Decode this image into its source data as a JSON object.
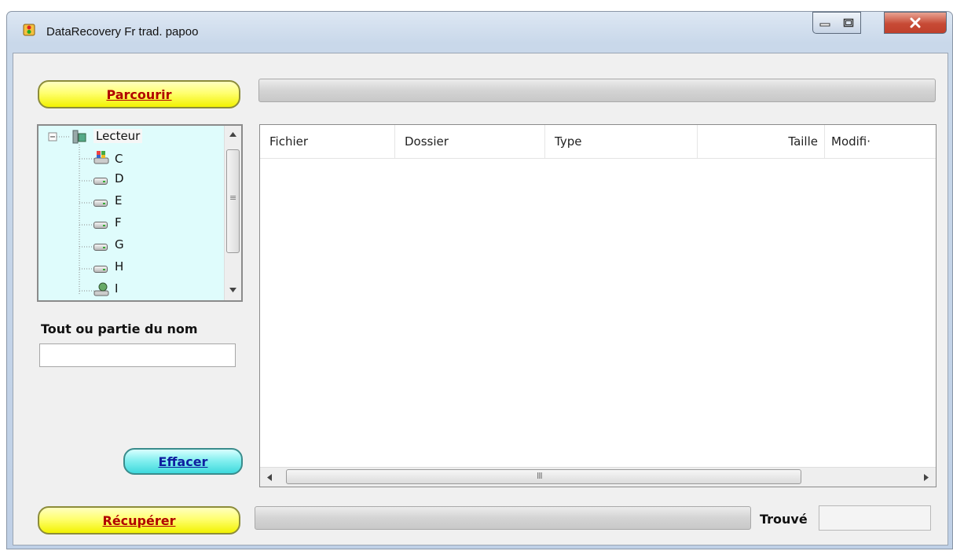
{
  "window": {
    "title": "DataRecovery Fr trad. papoo",
    "controls": {
      "minimize": "—",
      "maximize": "□",
      "close": "X"
    }
  },
  "toolbar": {
    "browse_label": "Parcourir",
    "browse_hotkey_letter": "P"
  },
  "tree": {
    "root": "Lecteur",
    "drives": [
      "C",
      "D",
      "E",
      "F",
      "G",
      "H",
      "I"
    ],
    "expand_symbol": "⊟",
    "scroll_mid_glyph": "≡"
  },
  "filter": {
    "label": "Tout ou partie du nom",
    "value": ""
  },
  "buttons": {
    "clear_label": "Effacer",
    "recover_label": "Récupérer"
  },
  "table": {
    "columns": [
      "Fichier",
      "Dossier",
      "Type",
      "Taille",
      "Modifi·"
    ],
    "rows": [],
    "hscroll_mid_glyph": "III"
  },
  "status": {
    "found_label": "Trouvé",
    "found_value": ""
  },
  "colors": {
    "yellow_button": "#ffff70",
    "cyan_button": "#86f0f0",
    "button_text_red": "#b00000",
    "button_text_blue": "#1020a0",
    "tree_background": "#dffcfc"
  }
}
